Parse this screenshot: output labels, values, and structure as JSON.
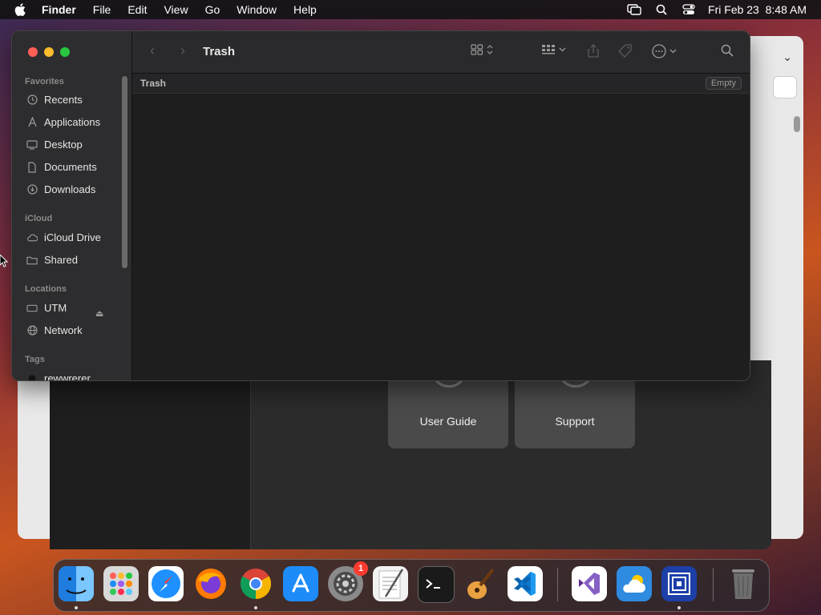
{
  "menubar": {
    "app_name": "Finder",
    "menus": [
      "File",
      "Edit",
      "View",
      "Go",
      "Window",
      "Help"
    ],
    "datetime": "Fri Feb 23  8:48 AM"
  },
  "background_window": {
    "cards": [
      {
        "label": "User Guide"
      },
      {
        "label": "Support"
      }
    ]
  },
  "finder": {
    "title": "Trash",
    "path_label": "Trash",
    "empty_button": "Empty",
    "sidebar": {
      "favorites_header": "Favorites",
      "favorites": [
        {
          "label": "Recents",
          "icon": "clock-icon"
        },
        {
          "label": "Applications",
          "icon": "applications-icon"
        },
        {
          "label": "Desktop",
          "icon": "desktop-icon"
        },
        {
          "label": "Documents",
          "icon": "document-icon"
        },
        {
          "label": "Downloads",
          "icon": "download-icon"
        }
      ],
      "icloud_header": "iCloud",
      "icloud": [
        {
          "label": "iCloud Drive",
          "icon": "cloud-icon"
        },
        {
          "label": "Shared",
          "icon": "shared-folder-icon"
        }
      ],
      "locations_header": "Locations",
      "locations": [
        {
          "label": "UTM",
          "icon": "drive-icon"
        },
        {
          "label": "Network",
          "icon": "globe-icon"
        }
      ],
      "tags_header": "Tags",
      "tags": [
        {
          "label": "rewwrerer"
        }
      ]
    }
  },
  "dock": {
    "apps": [
      {
        "name": "Finder",
        "icon": "finder-icon",
        "color": "#3b8ef0",
        "running": true
      },
      {
        "name": "Launchpad",
        "icon": "launchpad-icon",
        "color": "#d9d9d9",
        "running": false
      },
      {
        "name": "Safari",
        "icon": "safari-icon",
        "color": "#1e90ff",
        "running": false
      },
      {
        "name": "Firefox",
        "icon": "firefox-icon",
        "color": "#ff7a00",
        "running": false
      },
      {
        "name": "Chrome",
        "icon": "chrome-icon",
        "color": "#ffffff",
        "running": true
      },
      {
        "name": "App Store",
        "icon": "appstore-icon",
        "color": "#1d8cf8",
        "running": false
      },
      {
        "name": "System Settings",
        "icon": "settings-icon",
        "color": "#8a8a8a",
        "running": false,
        "badge": "1"
      },
      {
        "name": "TextEdit",
        "icon": "textedit-icon",
        "color": "#f2f2f2",
        "running": false
      },
      {
        "name": "Terminal",
        "icon": "terminal-icon",
        "color": "#1a1a1a",
        "running": false
      },
      {
        "name": "GarageBand",
        "icon": "garageband-icon",
        "color": "#e8a040",
        "running": false
      },
      {
        "name": "VS Code",
        "icon": "vscode-icon",
        "color": "#ffffff",
        "running": false
      },
      {
        "name": "Visual Studio",
        "icon": "visualstudio-icon",
        "color": "#ffffff",
        "running": false
      },
      {
        "name": "Weather",
        "icon": "weather-icon",
        "color": "#2e8be0",
        "running": false
      },
      {
        "name": "Remote Desktop",
        "icon": "remote-desktop-icon",
        "color": "#1c3fa8",
        "running": true
      },
      {
        "name": "Trash",
        "icon": "trash-icon",
        "color": "#7a7a7a",
        "running": false
      }
    ]
  }
}
